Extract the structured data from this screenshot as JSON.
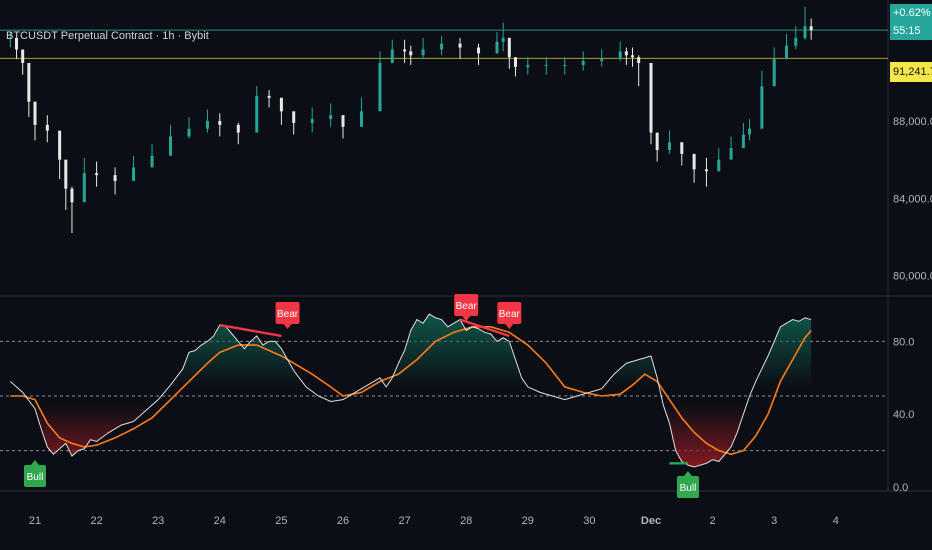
{
  "header": {
    "title": "BTCUSDT Perpetual Contract · 1h · Bybit"
  },
  "badges": {
    "change": "+0.62%",
    "countdown": "55:15",
    "price": "91,241.7",
    "change_color": "#26a69a",
    "price_color": "#f5e74a"
  },
  "colors": {
    "background": "#0c0e15",
    "bull_candle": "#26a69a",
    "bear_candle": "#e8e8e8",
    "rsi_line": "#e0e0e0",
    "rsi_ma": "#ff7a1a",
    "bull_label": "#2fa84f",
    "bear_label": "#f23645",
    "ob_fill": "#0f5a4c",
    "os_fill": "#8a1a22"
  },
  "chart_data": [
    {
      "type": "candlestick",
      "title": "BTCUSDT Perpetual Contract · 1h · Bybit",
      "x_ticks": [
        "21",
        "22",
        "23",
        "24",
        "25",
        "26",
        "27",
        "28",
        "29",
        "30",
        "Dec",
        "2",
        "3",
        "4"
      ],
      "y_ticks": [
        "80,000.0",
        "84,000.0",
        "88,000.0"
      ],
      "ylim": [
        79000,
        94000
      ],
      "reference_lines": [
        {
          "price": 92700,
          "color": "#2a8f86"
        },
        {
          "price": 91241.7,
          "color": "#a89a3a"
        }
      ],
      "series": [
        {
          "x": [
            20.6,
            20.7,
            20.8,
            20.9,
            21.0,
            21.2,
            21.4,
            21.5,
            21.6,
            21.8,
            22.0,
            22.3,
            22.6,
            22.9,
            23.2,
            23.5,
            23.8,
            24.0,
            24.3,
            24.6,
            24.8,
            25.0,
            25.2,
            25.5,
            25.8,
            26.0,
            26.3,
            26.6,
            26.8,
            27.0,
            27.1,
            27.3,
            27.6,
            27.9,
            28.2,
            28.5,
            28.6,
            28.7,
            28.8,
            29.0,
            29.3,
            29.6,
            29.9,
            30.2,
            30.5,
            30.6,
            30.7,
            30.8,
            31.0,
            31.1,
            31.3,
            31.5,
            31.7,
            31.9,
            32.1,
            32.3,
            32.5,
            32.6,
            32.8,
            33.0,
            33.2,
            33.35,
            33.5,
            33.6
          ],
          "close": [
            92300,
            91700,
            91000,
            89000,
            87800,
            87500,
            86000,
            84500,
            83800,
            85300,
            85200,
            84900,
            85600,
            86200,
            87200,
            87600,
            88000,
            87800,
            87400,
            89300,
            89200,
            88500,
            87900,
            88100,
            88300,
            87700,
            88500,
            91000,
            91700,
            91600,
            91400,
            91700,
            92000,
            91800,
            91500,
            92100,
            92300,
            91300,
            90800,
            90900,
            90900,
            90900,
            91100,
            91200,
            91600,
            91400,
            91300,
            91000,
            87400,
            86500,
            86900,
            86300,
            85500,
            85400,
            86000,
            86600,
            87300,
            87600,
            89800,
            91200,
            91900,
            92300,
            92900,
            92700
          ],
          "range": [
            [
              91800,
              92600
            ],
            [
              91200,
              92200
            ],
            [
              90400,
              91600
            ],
            [
              88200,
              90000
            ],
            [
              87000,
              88800
            ],
            [
              86900,
              88300
            ],
            [
              85000,
              86900
            ],
            [
              83400,
              85200
            ],
            [
              82200,
              84600
            ],
            [
              84500,
              86100
            ],
            [
              84600,
              85900
            ],
            [
              84200,
              85600
            ],
            [
              85000,
              86200
            ],
            [
              85600,
              86800
            ],
            [
              86600,
              87800
            ],
            [
              87100,
              88200
            ],
            [
              87400,
              88600
            ],
            [
              87200,
              88400
            ],
            [
              86800,
              87900
            ],
            [
              88600,
              89800
            ],
            [
              88700,
              89600
            ],
            [
              87800,
              89200
            ],
            [
              87300,
              88500
            ],
            [
              87400,
              88700
            ],
            [
              87700,
              88900
            ],
            [
              87100,
              88300
            ],
            [
              87900,
              89200
            ],
            [
              90200,
              91600
            ],
            [
              91100,
              92200
            ],
            [
              91000,
              92200
            ],
            [
              90900,
              91900
            ],
            [
              91200,
              92300
            ],
            [
              91400,
              92400
            ],
            [
              91200,
              92300
            ],
            [
              90900,
              92000
            ],
            [
              91500,
              92600
            ],
            [
              91600,
              93100
            ],
            [
              90700,
              91900
            ],
            [
              90300,
              91300
            ],
            [
              90400,
              91300
            ],
            [
              90400,
              91300
            ],
            [
              90400,
              91300
            ],
            [
              90600,
              91600
            ],
            [
              90800,
              91700
            ],
            [
              91100,
              92100
            ],
            [
              90900,
              91800
            ],
            [
              90800,
              91800
            ],
            [
              89800,
              91400
            ],
            [
              86800,
              88200
            ],
            [
              85900,
              87200
            ],
            [
              86300,
              87500
            ],
            [
              85700,
              86900
            ],
            [
              84800,
              86200
            ],
            [
              84600,
              86100
            ],
            [
              85400,
              86600
            ],
            [
              86000,
              87200
            ],
            [
              86700,
              87900
            ],
            [
              87000,
              88100
            ],
            [
              89000,
              90600
            ],
            [
              90500,
              91800
            ],
            [
              91200,
              92500
            ],
            [
              91700,
              92900
            ],
            [
              92200,
              93900
            ],
            [
              92200,
              93300
            ]
          ]
        }
      ]
    },
    {
      "type": "line",
      "x_ticks": [
        "21",
        "22",
        "23",
        "24",
        "25",
        "26",
        "27",
        "28",
        "29",
        "30",
        "Dec",
        "2",
        "3",
        "4"
      ],
      "y_ticks": [
        "0.0",
        "40.0",
        "80.0"
      ],
      "ylim": [
        0,
        100
      ],
      "levels": [
        80,
        50,
        20
      ],
      "series": [
        {
          "name": "RSI",
          "x": [
            20.6,
            20.8,
            21.0,
            21.1,
            21.2,
            21.3,
            21.4,
            21.5,
            21.6,
            21.7,
            21.8,
            21.9,
            22.0,
            22.2,
            22.4,
            22.6,
            22.8,
            23.0,
            23.2,
            23.4,
            23.5,
            23.6,
            23.7,
            23.8,
            23.9,
            24.0,
            24.1,
            24.2,
            24.3,
            24.4,
            24.5,
            24.6,
            24.7,
            24.8,
            24.9,
            25.0,
            25.1,
            25.2,
            25.4,
            25.6,
            25.8,
            26.0,
            26.2,
            26.4,
            26.6,
            26.7,
            26.8,
            26.9,
            27.0,
            27.1,
            27.2,
            27.3,
            27.4,
            27.5,
            27.6,
            27.7,
            27.8,
            27.9,
            28.0,
            28.1,
            28.2,
            28.3,
            28.4,
            28.5,
            28.6,
            28.7,
            28.8,
            28.9,
            29.0,
            29.2,
            29.4,
            29.6,
            29.8,
            30.0,
            30.2,
            30.4,
            30.6,
            30.8,
            31.0,
            31.1,
            31.2,
            31.3,
            31.4,
            31.5,
            31.6,
            31.7,
            31.8,
            31.9,
            32.0,
            32.1,
            32.2,
            32.3,
            32.4,
            32.5,
            32.6,
            32.7,
            32.8,
            32.9,
            33.0,
            33.1,
            33.2,
            33.3,
            33.4,
            33.5,
            33.6
          ],
          "values": [
            58,
            52,
            43,
            32,
            22,
            18,
            21,
            24,
            17,
            20,
            21,
            26,
            25,
            30,
            34,
            36,
            42,
            48,
            56,
            65,
            74,
            75,
            78,
            80,
            83,
            89,
            88,
            84,
            80,
            76,
            80,
            83,
            78,
            80,
            80,
            76,
            70,
            64,
            55,
            50,
            47,
            48,
            52,
            56,
            60,
            55,
            60,
            68,
            75,
            86,
            92,
            90,
            95,
            93,
            92,
            88,
            90,
            92,
            86,
            88,
            87,
            85,
            84,
            80,
            82,
            80,
            70,
            60,
            55,
            52,
            50,
            48,
            50,
            52,
            54,
            62,
            68,
            70,
            72,
            60,
            45,
            35,
            20,
            14,
            12,
            11,
            12,
            13,
            15,
            14,
            18,
            22,
            30,
            40,
            50,
            58,
            65,
            72,
            80,
            88,
            90,
            92,
            91,
            93,
            92
          ]
        },
        {
          "name": "RSI MA",
          "x": [
            20.6,
            20.8,
            21.0,
            21.2,
            21.4,
            21.6,
            21.8,
            22.0,
            22.3,
            22.6,
            22.9,
            23.2,
            23.5,
            23.8,
            24.0,
            24.3,
            24.6,
            24.8,
            25.0,
            25.2,
            25.5,
            25.8,
            26.0,
            26.3,
            26.6,
            26.9,
            27.2,
            27.5,
            27.8,
            28.1,
            28.4,
            28.7,
            29.0,
            29.3,
            29.6,
            29.9,
            30.2,
            30.5,
            30.7,
            30.9,
            31.1,
            31.3,
            31.5,
            31.7,
            31.9,
            32.1,
            32.3,
            32.5,
            32.7,
            32.9,
            33.1,
            33.3,
            33.5,
            33.6
          ],
          "values": [
            50,
            50,
            48,
            35,
            27,
            24,
            22,
            23,
            27,
            32,
            38,
            48,
            58,
            68,
            74,
            78,
            78,
            75,
            72,
            68,
            62,
            55,
            50,
            52,
            58,
            62,
            70,
            80,
            85,
            88,
            88,
            85,
            78,
            68,
            55,
            52,
            50,
            51,
            56,
            62,
            58,
            48,
            38,
            30,
            24,
            20,
            18,
            20,
            28,
            40,
            58,
            70,
            82,
            86
          ]
        }
      ],
      "annotations": [
        {
          "label": "Bull",
          "x": 21.0,
          "type": "bull"
        },
        {
          "label": "Bear",
          "x": 25.1,
          "type": "bear"
        },
        {
          "label": "Bear",
          "x": 28.0,
          "type": "bear"
        },
        {
          "label": "Bear",
          "x": 28.7,
          "type": "bear"
        },
        {
          "label": "Bull",
          "x": 31.6,
          "type": "bull"
        }
      ],
      "divergence_lines": [
        {
          "x": [
            24.0,
            25.0
          ],
          "y": [
            89,
            83
          ],
          "color": "#f23645"
        },
        {
          "x": [
            27.9,
            28.7
          ],
          "y": [
            92,
            83
          ],
          "color": "#f23645"
        },
        {
          "x": [
            31.3,
            31.6
          ],
          "y": [
            13,
            13
          ],
          "color": "#2fa84f"
        }
      ]
    }
  ]
}
